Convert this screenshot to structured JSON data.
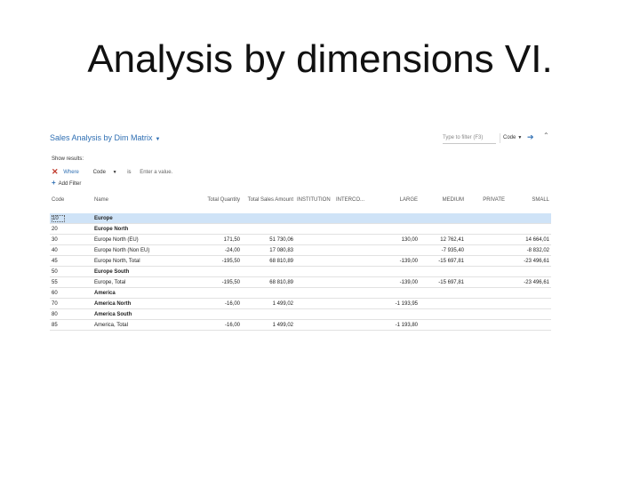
{
  "slide": {
    "title": "Analysis by dimensions VI."
  },
  "page": {
    "heading": "Sales Analysis by Dim Matrix",
    "filter_placeholder": "Type to filter (F3)",
    "filter_field": "Code"
  },
  "filters": {
    "show_results_label": "Show results:",
    "where_label": "Where",
    "field_label": "Code",
    "is_label": "is",
    "value_placeholder": "Enter a value.",
    "add_filter_label": "Add Filter"
  },
  "columns": {
    "code": "Code",
    "name": "Name",
    "total_quantity": "Total Quantity",
    "total_sales_amount": "Total Sales Amount",
    "institution": "INSTITUTION",
    "interco": "INTERCO...",
    "large": "LARGE",
    "medium": "MEDIUM",
    "private": "PRIVATE",
    "small": "SMALL"
  },
  "rows": [
    {
      "code": "10",
      "name": "Europe",
      "qty": "",
      "sales": "",
      "inst": "",
      "interco": "",
      "large": "",
      "medium": "",
      "private": "",
      "small": ""
    },
    {
      "code": "20",
      "name": "Europe North",
      "qty": "",
      "sales": "",
      "inst": "",
      "interco": "",
      "large": "",
      "medium": "",
      "private": "",
      "small": ""
    },
    {
      "code": "30",
      "name": "Europe North (EU)",
      "qty": "171,50",
      "sales": "51 730,06",
      "inst": "",
      "interco": "",
      "large": "130,00",
      "medium": "12 762,41",
      "private": "",
      "small": "14 664,01"
    },
    {
      "code": "40",
      "name": "Europe North (Non EU)",
      "qty": "-24,00",
      "sales": "17 080,83",
      "inst": "",
      "interco": "",
      "large": "",
      "medium": "-7 935,40",
      "private": "",
      "small": "-8 832,02"
    },
    {
      "code": "45",
      "name": "Europe North, Total",
      "qty": "-195,50",
      "sales": "68 810,89",
      "inst": "",
      "interco": "",
      "large": "-139,00",
      "medium": "-15 697,81",
      "private": "",
      "small": "-23 496,61"
    },
    {
      "code": "50",
      "name": "Europe South",
      "qty": "",
      "sales": "",
      "inst": "",
      "interco": "",
      "large": "",
      "medium": "",
      "private": "",
      "small": ""
    },
    {
      "code": "55",
      "name": "Europe, Total",
      "qty": "-195,50",
      "sales": "68 810,89",
      "inst": "",
      "interco": "",
      "large": "-139,00",
      "medium": "-15 697,81",
      "private": "",
      "small": "-23 496,61"
    },
    {
      "code": "60",
      "name": "America",
      "qty": "",
      "sales": "",
      "inst": "",
      "interco": "",
      "large": "",
      "medium": "",
      "private": "",
      "small": ""
    },
    {
      "code": "70",
      "name": "America North",
      "qty": "-16,00",
      "sales": "1 499,02",
      "inst": "",
      "interco": "",
      "large": "-1 193,95",
      "medium": "",
      "private": "",
      "small": ""
    },
    {
      "code": "80",
      "name": "America South",
      "qty": "",
      "sales": "",
      "inst": "",
      "interco": "",
      "large": "",
      "medium": "",
      "private": "",
      "small": ""
    },
    {
      "code": "85",
      "name": "America, Total",
      "qty": "-16,00",
      "sales": "1 499,02",
      "inst": "",
      "interco": "",
      "large": "-1 193,80",
      "medium": "",
      "private": "",
      "small": ""
    }
  ],
  "colors": {
    "accent": "#2f6fb3",
    "selected_row": "#cfe3f7",
    "remove_filter": "#c0392b"
  },
  "icons": {
    "remove_filter": "close-icon",
    "add_filter": "plus-icon",
    "go": "arrow-right-icon",
    "collapse": "chevron-up-icon"
  }
}
